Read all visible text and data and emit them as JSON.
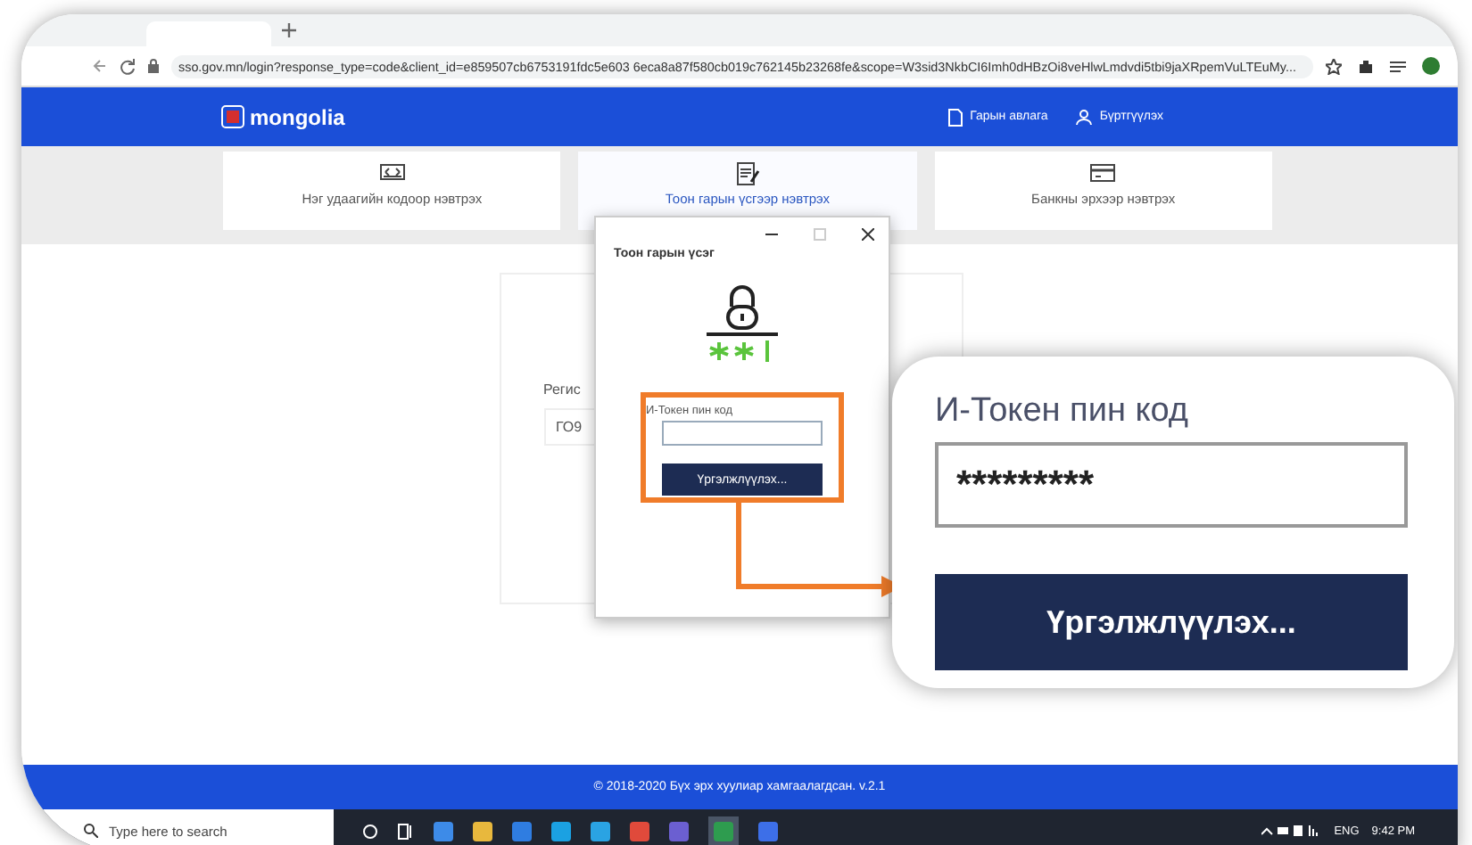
{
  "browser": {
    "url": "sso.gov.mn/login?response_type=code&client_id=e859507cb6753191fdc5e603 6eca8a87f580cb019c762145b23268fe&scope=W3sid3NkbCI6Imh0dHBzOi8veHlwLmdvdi5tbi9jaXRpemVuLTEuMy..."
  },
  "header": {
    "logo": "mongolia",
    "links": [
      {
        "kind": "guide",
        "label": "Гарын авлага"
      },
      {
        "kind": "user",
        "label": "Бүртгүүлэх"
      }
    ]
  },
  "tabs": [
    {
      "kind": "code",
      "label": "Нэг удаагийн кодоор нэвтрэх",
      "selected": false
    },
    {
      "kind": "signature",
      "label": "Тоон гарын үсгээр нэвтрэх",
      "selected": true
    },
    {
      "kind": "bank",
      "label": "Банкны эрхээр нэвтрэх",
      "selected": false
    }
  ],
  "login_form": {
    "label": "Регис",
    "field_value": "ГО9"
  },
  "dialog": {
    "title": "Тоон гарын үсэг",
    "pin_label": "И-Токен пин код",
    "button": "Үргэлжлүүлэх..."
  },
  "callout": {
    "pin_label": "И-Токен пин код",
    "pin_value": "*********",
    "button": "Үргэлжлүүлэх..."
  },
  "footer": {
    "text": "© 2018-2020 Бүх эрх хуулиар хамгаалагдсан. v.2.1"
  },
  "taskbar": {
    "search_placeholder": "Type here to search",
    "language": "ENG",
    "time": "9:42 PM"
  }
}
